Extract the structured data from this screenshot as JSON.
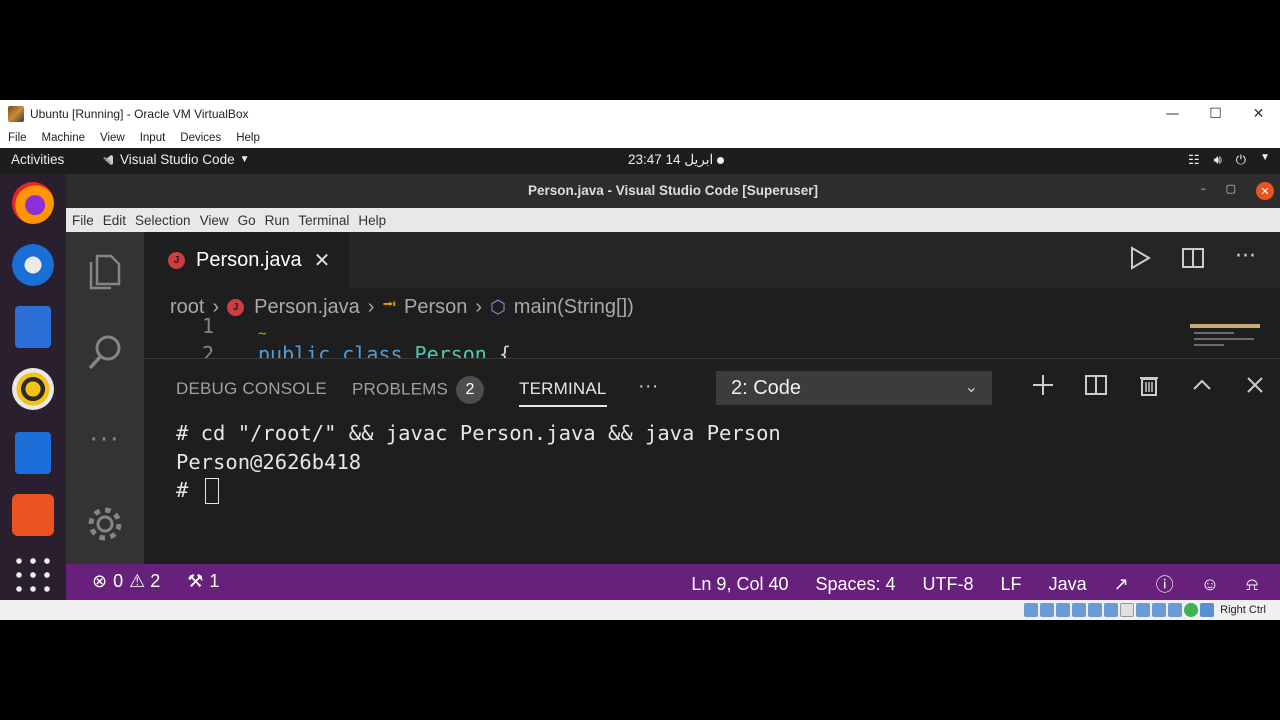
{
  "vbox": {
    "title": "Ubuntu [Running] - Oracle VM VirtualBox",
    "menu": [
      "File",
      "Machine",
      "View",
      "Input",
      "Devices",
      "Help"
    ],
    "host_key": "Right Ctrl"
  },
  "gnome": {
    "activities": "Activities",
    "app_menu": "Visual Studio Code",
    "clock": "23:47  ابريل 14"
  },
  "vscode": {
    "window_title": "Person.java - Visual Studio Code [Superuser]",
    "menu": [
      "File",
      "Edit",
      "Selection",
      "View",
      "Go",
      "Run",
      "Terminal",
      "Help"
    ],
    "tab": {
      "label": "Person.java",
      "icon_letter": "J"
    },
    "breadcrumb": [
      "root",
      "Person.java",
      "Person",
      "main(String[])"
    ],
    "code_peek": {
      "line1_number": "1",
      "line2_number": "2",
      "line2_tokens": [
        {
          "text": "public ",
          "color": "#569cd6"
        },
        {
          "text": "class ",
          "color": "#569cd6"
        },
        {
          "text": "Person ",
          "color": "#4ec9b0"
        },
        {
          "text": "{",
          "color": "#d4d4d4"
        }
      ]
    },
    "panel": {
      "tabs": [
        "DEBUG CONSOLE",
        "PROBLEMS",
        "TERMINAL"
      ],
      "problems_count": "2",
      "more": "···",
      "terminal_select": "2: Code",
      "terminal_lines": [
        "# cd \"/root/\" && javac Person.java && java Person",
        "Person@2626b418",
        "# "
      ]
    },
    "status": {
      "errors": "0",
      "warnings": "2",
      "tools": "1",
      "position": "Ln 9, Col 40",
      "spaces": "Spaces: 4",
      "encoding": "UTF-8",
      "eol": "LF",
      "language": "Java"
    }
  },
  "colors": {
    "statusbar": "#68217a",
    "accent_close": "#e95420",
    "java_icon": "#cc3e44"
  }
}
